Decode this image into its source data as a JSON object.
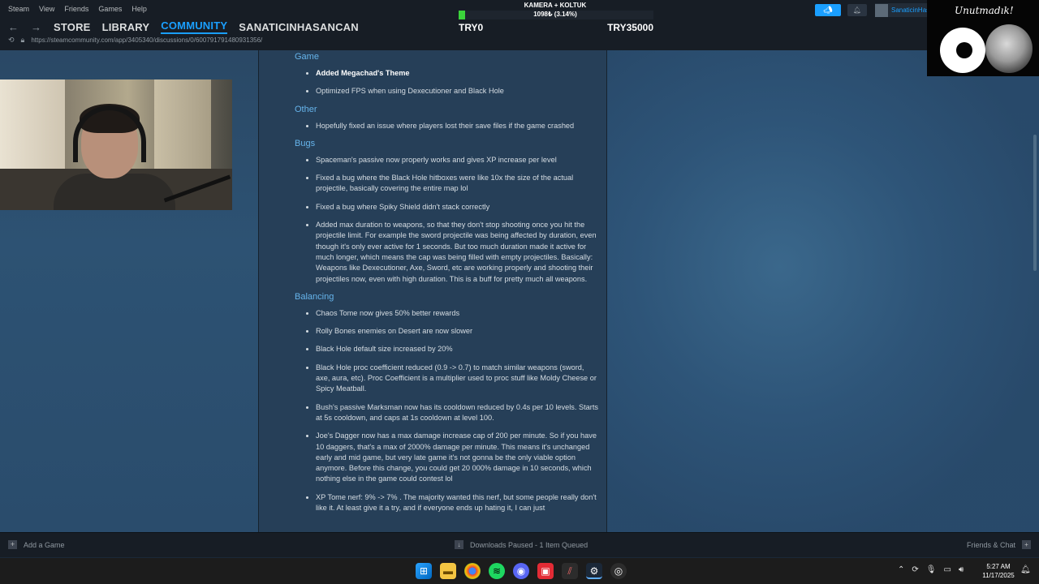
{
  "menu": [
    "Steam",
    "View",
    "Friends",
    "Games",
    "Help"
  ],
  "nav": {
    "back_icon": "arrow-left-icon",
    "forward_icon": "arrow-right-icon",
    "tabs": [
      "STORE",
      "LIBRARY",
      "COMMUNITY",
      "SANATICINHASANCAN"
    ],
    "active_tab": "COMMUNITY"
  },
  "url": "https://steamcommunity.com/app/3405340/discussions/0/600791791480931356/",
  "overlay": {
    "title": "KAMERA + KOLTUK",
    "value": "1098₺ (3.14%)",
    "progress_percent": 3.14,
    "min_label": "TRY0",
    "max_label": "TRY35000"
  },
  "user": {
    "name": "SanaticinHasancan"
  },
  "logo": {
    "signature": "Unutmadık!"
  },
  "article": {
    "sections": [
      {
        "heading": "Game",
        "items": [
          {
            "text": "Added Megachad's Theme",
            "bold": true
          },
          {
            "text": "Optimized FPS when using Dexecutioner and Black Hole"
          }
        ]
      },
      {
        "heading": "Other",
        "items": [
          {
            "text": "Hopefully fixed an issue where players lost their save files if the game crashed"
          }
        ]
      },
      {
        "heading": "Bugs",
        "items": [
          {
            "text": "Spaceman's passive now properly works and gives XP increase per level"
          },
          {
            "text": "Fixed a bug where the Black Hole hitboxes were like 10x the size of the actual projectile, basically covering the entire map lol"
          },
          {
            "text": "Fixed a bug where Spiky Shield didn't stack correctly"
          },
          {
            "text": "Added max duration to weapons, so that they don't stop shooting once you hit the projectile limit. For example the sword projectile was being affected by duration, even though it's only ever active for 1 seconds. But too much duration made it active for much longer, which means the cap was being filled with empty projectiles. Basically: Weapons like Dexecutioner, Axe, Sword, etc are working properly and shooting their projectiles now, even with high duration. This is a buff for pretty much all weapons."
          }
        ]
      },
      {
        "heading": "Balancing",
        "items": [
          {
            "text": "Chaos Tome now gives 50% better rewards"
          },
          {
            "text": "Rolly Bones enemies on Desert are now slower"
          },
          {
            "text": "Black Hole default size increased by 20%"
          },
          {
            "text": "Black Hole proc coefficient reduced (0.9 -> 0.7) to match similar weapons (sword, axe, aura, etc). Proc Coefficient is a multiplier used to proc stuff like Moldy Cheese or Spicy Meatball."
          },
          {
            "text": "Bush's passive Marksman now has its cooldown reduced by 0.4s per 10 levels. Starts at 5s cooldown, and caps at 1s cooldown at level 100."
          },
          {
            "text": "Joe's Dagger now has a max damage increase cap of 200 per minute. So if you have 10 daggers, that's a max of 2000% damage per minute. This means it's unchanged early and mid game, but very late game it's not gonna be the only viable option anymore. Before this change, you could get 20 000% damage in 10 seconds, which nothing else in the game could contest lol"
          },
          {
            "text": "XP Tome nerf: 9% -> 7% . The majority wanted this nerf, but some people really don't like it. At least give it a try, and if everyone ends up hating it, I can just"
          }
        ]
      }
    ]
  },
  "bottom": {
    "add_game": "Add a Game",
    "downloads": "Downloads Paused - 1 Item Queued",
    "friends": "Friends & Chat"
  },
  "taskbar": {
    "time": "5:27 AM",
    "date": "11/17/2025"
  }
}
